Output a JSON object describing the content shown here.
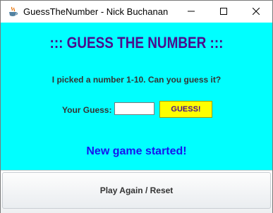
{
  "window": {
    "title": "GuessTheNumber - Nick Buchanan",
    "app_icon": "java-coffee-icon",
    "controls": [
      "minimize-icon",
      "maximize-icon",
      "close-icon"
    ]
  },
  "main": {
    "heading": "::: GUESS THE NUMBER :::",
    "prompt": "I picked a number 1-10. Can you guess it?",
    "guess_label": "Your Guess:",
    "guess_value": "",
    "guess_button": "GUESS!",
    "status": "New game started!"
  },
  "footer": {
    "reset_button": "Play Again / Reset"
  },
  "colors": {
    "background": "#00ffff",
    "heading": "#4b0d8c",
    "status": "#1515ee",
    "guess_button": "#ffff00"
  }
}
